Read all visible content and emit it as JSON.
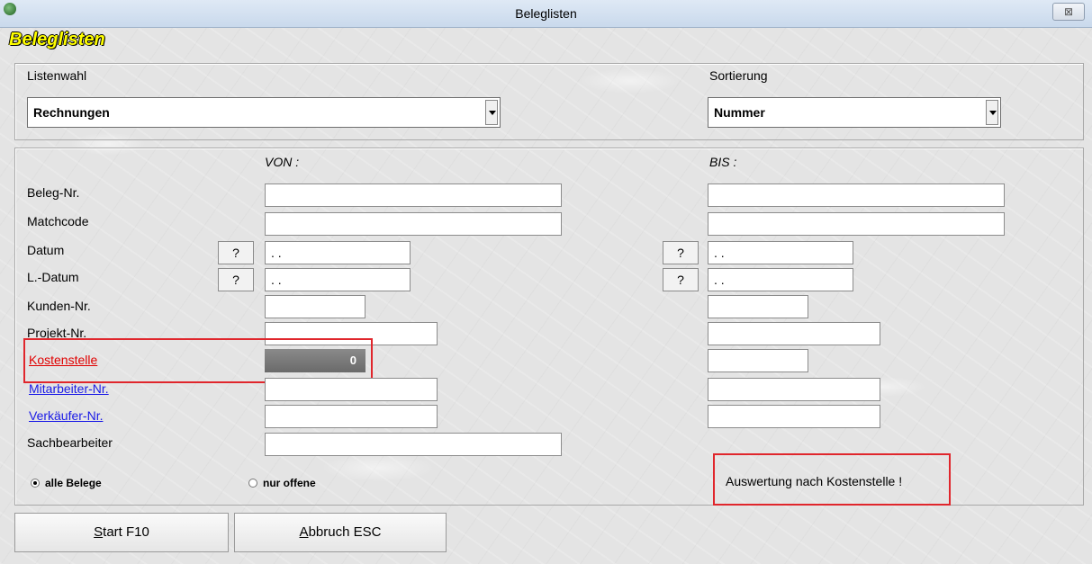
{
  "window": {
    "title": "Beleglisten",
    "close_glyph": "⊠"
  },
  "heading": "Beleglisten",
  "listenwahl": {
    "label": "Listenwahl",
    "value": "Rechnungen"
  },
  "sortierung": {
    "label": "Sortierung",
    "value": "Nummer"
  },
  "columns": {
    "von": "VON :",
    "bis": "BIS :"
  },
  "fields": {
    "beleg_nr": "Beleg-Nr.",
    "matchcode": "Matchcode",
    "datum": "Datum",
    "l_datum": "L.-Datum",
    "kunden_nr": "Kunden-Nr.",
    "projekt_nr": "Projekt-Nr.",
    "kostenstelle": "Kostenstelle",
    "mitarbeiter_nr": "Mitarbeiter-Nr.",
    "verkaeufer_nr": "Verkäufer-Nr.",
    "sachbearbeiter": "Sachbearbeiter"
  },
  "values": {
    "datum_von": ". .",
    "l_datum_von": ". .",
    "datum_bis": ". .",
    "l_datum_bis": ". .",
    "kostenstelle_von": "0"
  },
  "question_mark": "?",
  "radios": {
    "alle": "alle Belege",
    "offene": "nur offene",
    "selected": "alle"
  },
  "info_text": "Auswertung nach Kostenstelle !",
  "buttons": {
    "start_key": "S",
    "start_rest": "tart F10",
    "abbruch_key": "A",
    "abbruch_rest": "bbruch ESC"
  },
  "colors": {
    "heading": "#ffff00",
    "highlight": "#e0262c",
    "link": "#1a1ae6"
  }
}
